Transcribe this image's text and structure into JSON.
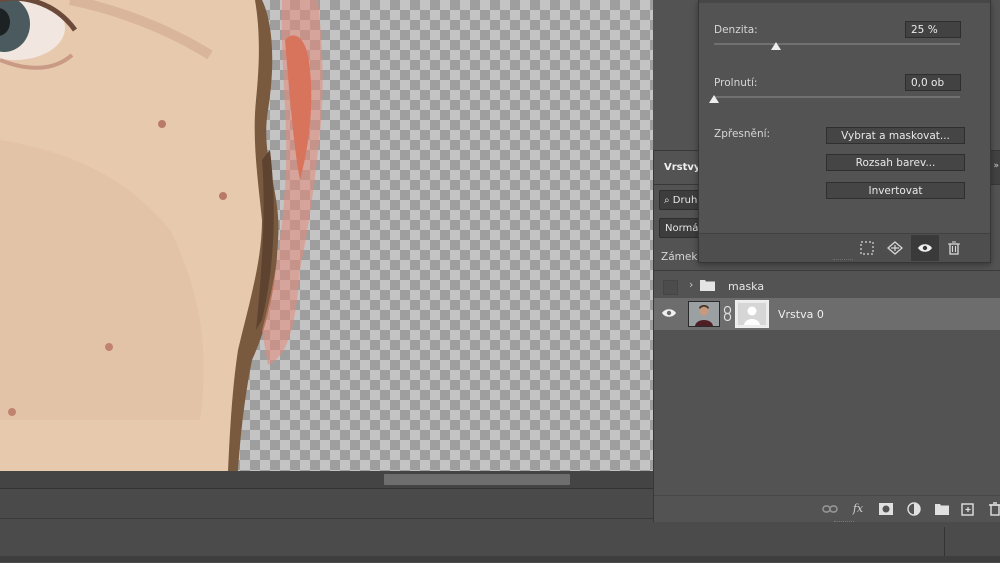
{
  "layers_panel": {
    "tab_title": "Vrstvy",
    "collapse_glyph": "»",
    "filter_label": "Druh",
    "blend_mode": "Normál",
    "lock_label": "Zámek:",
    "group_layer_name": "maska",
    "layer_name": "Vrstva 0",
    "footer_icons": [
      "link-icon",
      "fx-icon",
      "mask-icon",
      "adjustment-icon",
      "folder-icon",
      "new-layer-icon",
      "trash-icon"
    ],
    "fx_label": "fx"
  },
  "properties_panel": {
    "density_label": "Denzita:",
    "density_value": "25 %",
    "density_level": 0.25,
    "feather_label": "Prolnutí:",
    "feather_value": "0,0 ob",
    "feather_level": 0.0,
    "refine_label": "Zpřesnění:",
    "buttons": {
      "select_and_mask": "Vybrat a maskovat...",
      "color_range": "Rozsah barev...",
      "invert": "Invertovat"
    },
    "footer_icons": [
      "load-selection-icon",
      "apply-mask-icon",
      "visibility-eye-icon",
      "delete-mask-icon"
    ]
  },
  "colors": {
    "panel_bg": "#535353",
    "selected_layer": "#6d6d6d",
    "mask_overlay": "#e88a7a"
  }
}
